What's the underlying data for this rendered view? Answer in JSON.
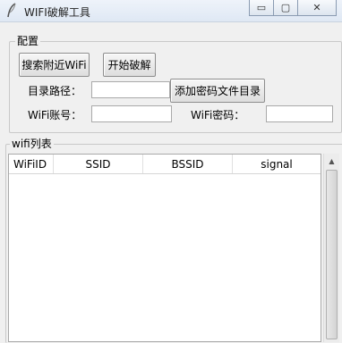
{
  "window": {
    "title": "WIFI破解工具",
    "controls": {
      "minimize": "▭",
      "maximize": "▢",
      "close": "✕"
    }
  },
  "config": {
    "label": "配置",
    "scan_button": "搜索附近WiFi",
    "crack_button": "开始破解",
    "dir_label": "目录路径：",
    "dir_value": "",
    "add_dict_button": "添加密码文件目录",
    "account_label": "WiFi账号：",
    "account_value": "",
    "password_label": "WiFi密码：",
    "password_value": ""
  },
  "wifi_list": {
    "label": "wifi列表",
    "columns": [
      "WiFiID",
      "SSID",
      "BSSID",
      "signal"
    ],
    "rows": []
  }
}
